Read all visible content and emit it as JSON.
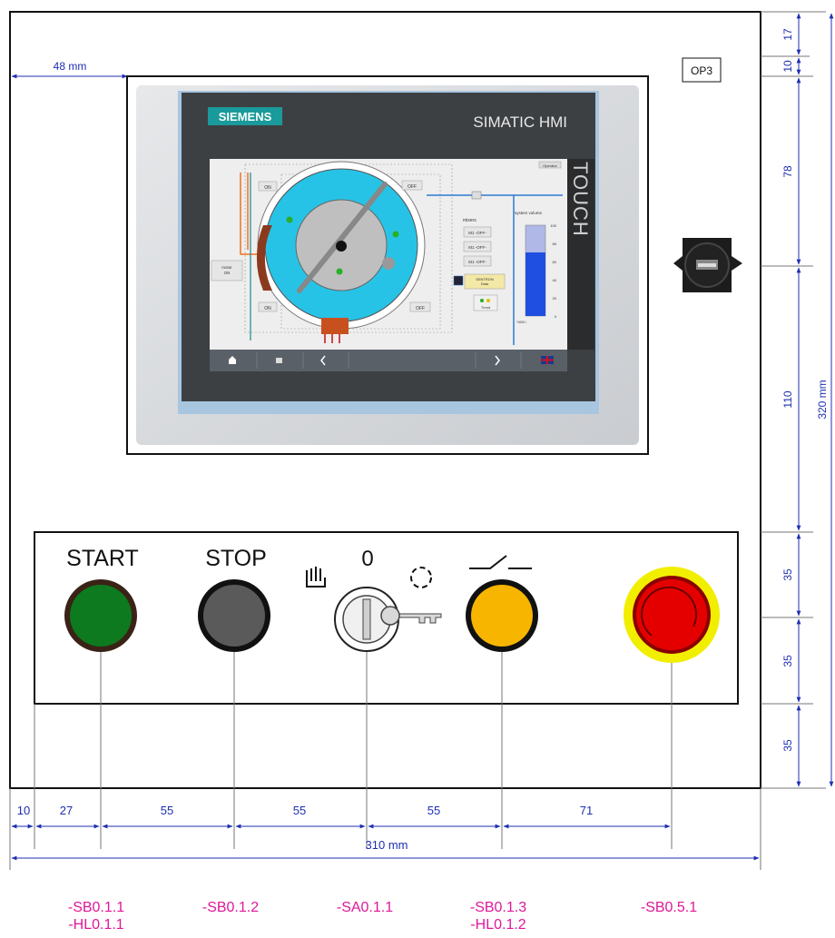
{
  "cabinet": {
    "label": "OP3",
    "width_label": "310 mm",
    "height_label": "320 mm",
    "left_offset_label": "48 mm"
  },
  "hmi": {
    "brand": "SIEMENS",
    "model": "SIMATIC HMI",
    "touch_label": "TOUCH",
    "screen": {
      "corner_label": "Operator",
      "tag_left_top": "ON",
      "tag_right_top": "OFF",
      "tag_left_bottom": "ON",
      "tag_right_bottom": "OFF",
      "motor_label": "motor\nON",
      "mixers_title": "mixers",
      "mixer_states": [
        "M1 -OFF-",
        "M1 -OFF-",
        "M1 -OFF-"
      ],
      "sentron_label": "SENTRON\nData",
      "trend_label": "Trend",
      "volume_title": "system volume",
      "volume_ticks": [
        "100",
        "80",
        "60",
        "40",
        "20",
        "0"
      ],
      "volume_unit": "*1000 l",
      "volume_level": 0.7
    }
  },
  "controls": {
    "start_label": "START",
    "stop_label": "STOP",
    "selector_label": "0",
    "colors": {
      "start": "#0d7a1f",
      "stop": "#5a5a5a",
      "aux": "#f7b500",
      "estop": "#e50000",
      "estop_ring": "#f2ee00"
    }
  },
  "dimensions": {
    "vertical": [
      "17",
      "10",
      "78",
      "110",
      "35",
      "35",
      "35"
    ],
    "horizontal": [
      "10",
      "27",
      "55",
      "55",
      "55",
      "71"
    ]
  },
  "device_tags": [
    {
      "line1": "-SB0.1.1",
      "line2": "-HL0.1.1"
    },
    {
      "line1": "-SB0.1.2",
      "line2": ""
    },
    {
      "line1": "-SA0.1.1",
      "line2": ""
    },
    {
      "line1": "-SB0.1.3",
      "line2": "-HL0.1.2"
    },
    {
      "line1": "-SB0.5.1",
      "line2": ""
    }
  ],
  "theme": {
    "dimension_color": "#1f2fb0",
    "tag_color": "#e0189a",
    "screen_cyan": "#27c3e6"
  }
}
